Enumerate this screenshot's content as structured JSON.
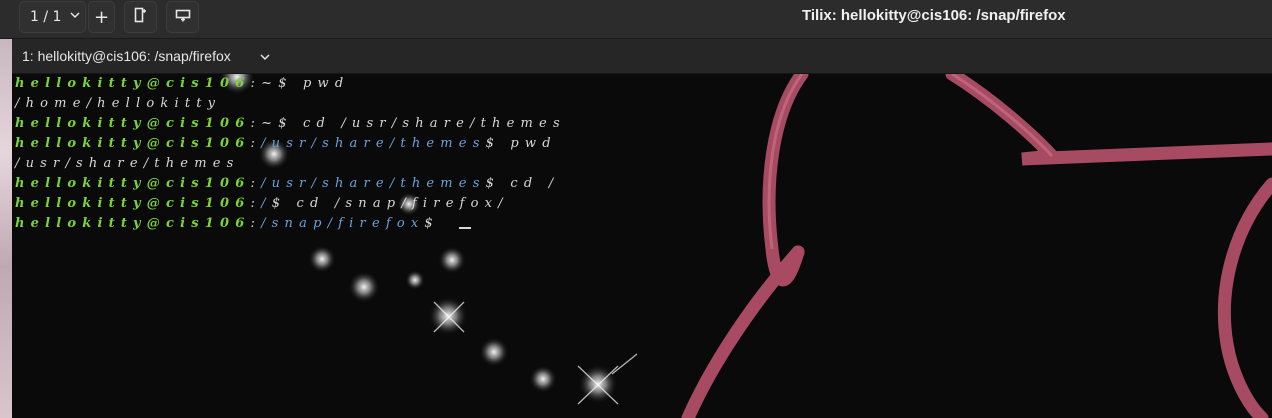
{
  "header": {
    "session_indicator": "1 / 1",
    "add_session_label": "+",
    "window_title": "Tilix: hellokitty@cis106: /snap/firefox"
  },
  "terminal_tab": {
    "title": "1: hellokitty@cis106: /snap/firefox"
  },
  "terminal": {
    "lines": [
      {
        "user": "hellokitty@cis106",
        "sep": ":",
        "path": "~",
        "suffix": "$ ",
        "command": "pwd",
        "path_color": "default"
      },
      {
        "output": "/home/hellokitty"
      },
      {
        "user": "hellokitty@cis106",
        "sep": ":",
        "path": "~",
        "suffix": "$ ",
        "command": "cd /usr/share/themes",
        "path_color": "default"
      },
      {
        "user": "hellokitty@cis106",
        "sep": ":",
        "path": "/usr/share/themes",
        "suffix": "$ ",
        "command": "pwd",
        "path_color": "blue"
      },
      {
        "output": "/usr/share/themes"
      },
      {
        "user": "hellokitty@cis106",
        "sep": ":",
        "path": "/usr/share/themes",
        "suffix": "$ ",
        "command": "cd /",
        "path_color": "blue"
      },
      {
        "user": "hellokitty@cis106",
        "sep": ":",
        "path": "/",
        "suffix": "$ ",
        "command": "cd /snap/firefox/",
        "path_color": "blue"
      },
      {
        "user": "hellokitty@cis106",
        "sep": ":",
        "path": "/snap/firefox",
        "suffix": "$ ",
        "command": "",
        "path_color": "blue",
        "cursor": true
      }
    ]
  },
  "icons": {
    "session_dropdown": "chevron-down-icon",
    "add_session": "plus-icon",
    "add_terminal_right": "split-right-icon",
    "add_terminal_down": "split-down-icon",
    "terminal_menu": "chevron-down-icon"
  },
  "colors": {
    "prompt_user": "#7bd437",
    "prompt_path": "#6aa2dc",
    "text": "#d8d8d8",
    "background_art_accent": "#c05a72"
  }
}
